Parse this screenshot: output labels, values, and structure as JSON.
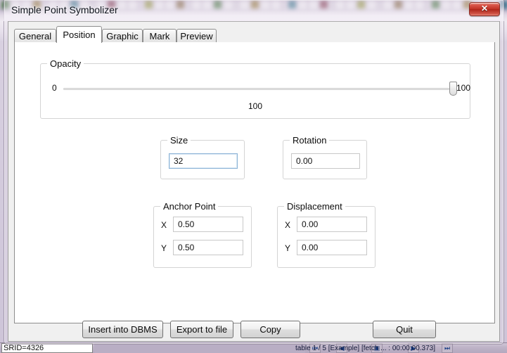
{
  "window": {
    "title": "Simple Point Symbolizer",
    "close_label": "✕",
    "close_icon": "close-icon"
  },
  "tabs": [
    {
      "label": "General",
      "active": false
    },
    {
      "label": "Position",
      "active": true
    },
    {
      "label": "Graphic",
      "active": false
    },
    {
      "label": "Mark",
      "active": false
    },
    {
      "label": "Preview",
      "active": false
    }
  ],
  "position_tab": {
    "opacity": {
      "group_label": "Opacity",
      "min_label": "0",
      "max_label": "100",
      "value": "100",
      "slider_percent": 100
    },
    "size": {
      "group_label": "Size",
      "value": "32",
      "focused": true
    },
    "rotation": {
      "group_label": "Rotation",
      "value": "0.00",
      "focused": false
    },
    "anchor_point": {
      "group_label": "Anchor Point",
      "x_label": "X",
      "x_value": "0.50",
      "y_label": "Y",
      "y_value": "0.50"
    },
    "displacement": {
      "group_label": "Displacement",
      "x_label": "X",
      "x_value": "0.00",
      "y_label": "Y",
      "y_value": "0.00"
    }
  },
  "buttons": {
    "insert_into_dbms": "Insert into DBMS",
    "export_to_file": "Export to file",
    "copy": "Copy",
    "quit": "Quit"
  },
  "background_app": {
    "srid_field": "SRID=4326",
    "nav_first_icon": "⏮",
    "nav_prev_icon": "◀",
    "nav_current_icon": "▣",
    "nav_next_icon": "▶",
    "nav_last_icon": "⏭",
    "status_text": "table 1 / 5 [Example] [fetch ... : 00:00:00.373]"
  },
  "colors": {
    "accent_focus_border": "#8bb3d6",
    "close_button": "#c23427",
    "panel": "#f0f0f0",
    "page": "#ffffff",
    "group_border": "#d4d4d4"
  }
}
